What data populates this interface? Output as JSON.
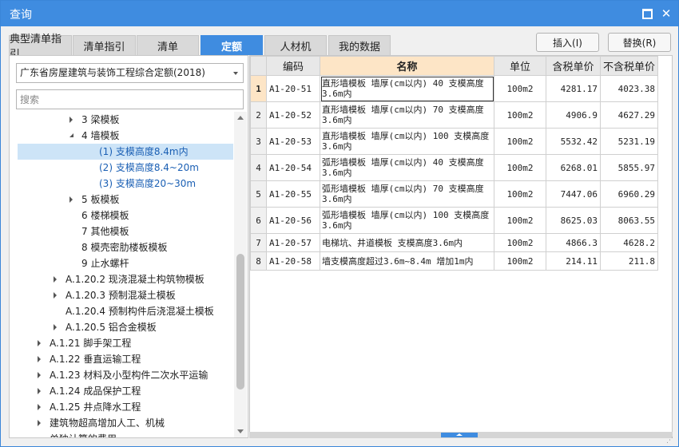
{
  "window": {
    "title": "查询"
  },
  "tabs": [
    {
      "label": "典型清单指引"
    },
    {
      "label": "清单指引"
    },
    {
      "label": "清单"
    },
    {
      "label": "定额",
      "active": true
    },
    {
      "label": "人材机"
    },
    {
      "label": "我的数据"
    }
  ],
  "actions": {
    "insert": "插入(I)",
    "replace": "替换(R)"
  },
  "left": {
    "quota_book": "广东省房屋建筑与装饰工程综合定额(2018)",
    "search_placeholder": "搜索",
    "tree": [
      {
        "label": "3 梁模板",
        "expander": "collapsed"
      },
      {
        "label": "4 墙模板",
        "expander": "expanded"
      },
      {
        "label": "(1) 支模高度8.4m内",
        "expander": "none",
        "selected": true
      },
      {
        "label": "(2) 支模高度8.4~20m",
        "expander": "none"
      },
      {
        "label": "(3) 支模高度20~30m",
        "expander": "none"
      },
      {
        "label": "5 板模板",
        "expander": "collapsed"
      },
      {
        "label": "6 楼梯模板",
        "expander": "none"
      },
      {
        "label": "7 其他模板",
        "expander": "none"
      },
      {
        "label": "8 模壳密肋楼板模板",
        "expander": "none"
      },
      {
        "label": "9 止水螺杆",
        "expander": "none"
      },
      {
        "label": "A.1.20.2 现浇混凝土构筑物模板",
        "expander": "collapsed"
      },
      {
        "label": "A.1.20.3 预制混凝土模板",
        "expander": "collapsed"
      },
      {
        "label": "A.1.20.4 预制构件后浇混凝土模板",
        "expander": "none"
      },
      {
        "label": "A.1.20.5 铝合金模板",
        "expander": "collapsed"
      },
      {
        "label": "A.1.21 脚手架工程",
        "expander": "collapsed"
      },
      {
        "label": "A.1.22 垂直运输工程",
        "expander": "collapsed"
      },
      {
        "label": "A.1.23 材料及小型构件二次水平运输",
        "expander": "collapsed"
      },
      {
        "label": "A.1.24 成品保护工程",
        "expander": "collapsed"
      },
      {
        "label": "A.1.25 井点降水工程",
        "expander": "collapsed"
      },
      {
        "label": "建筑物超高增加人工、机械",
        "expander": "collapsed"
      },
      {
        "label": "单独计算的费用",
        "expander": "none"
      }
    ]
  },
  "table": {
    "columns": [
      "",
      "编码",
      "名称",
      "单位",
      "含税单价",
      "不含税单价"
    ],
    "rows": [
      {
        "idx": "1",
        "code": "A1-20-51",
        "name": "直形墙模板 墙厚(cm以内) 40 支模高度3.6m内",
        "unit": "100m2",
        "tax_price": "4281.17",
        "notax_price": "4023.38"
      },
      {
        "idx": "2",
        "code": "A1-20-52",
        "name": "直形墙模板 墙厚(cm以内) 70 支模高度3.6m内",
        "unit": "100m2",
        "tax_price": "4906.9",
        "notax_price": "4627.29"
      },
      {
        "idx": "3",
        "code": "A1-20-53",
        "name": "直形墙模板 墙厚(cm以内) 100 支模高度3.6m内",
        "unit": "100m2",
        "tax_price": "5532.42",
        "notax_price": "5231.19"
      },
      {
        "idx": "4",
        "code": "A1-20-54",
        "name": "弧形墙模板 墙厚(cm以内) 40 支模高度3.6m内",
        "unit": "100m2",
        "tax_price": "6268.01",
        "notax_price": "5855.97"
      },
      {
        "idx": "5",
        "code": "A1-20-55",
        "name": "弧形墙模板 墙厚(cm以内) 70 支模高度3.6m内",
        "unit": "100m2",
        "tax_price": "7447.06",
        "notax_price": "6960.29"
      },
      {
        "idx": "6",
        "code": "A1-20-56",
        "name": "弧形墙模板 墙厚(cm以内) 100 支模高度3.6m内",
        "unit": "100m2",
        "tax_price": "8625.03",
        "notax_price": "8063.55"
      },
      {
        "idx": "7",
        "code": "A1-20-57",
        "name": "电梯坑、井道模板 支模高度3.6m内",
        "unit": "100m2",
        "tax_price": "4866.3",
        "notax_price": "4628.2"
      },
      {
        "idx": "8",
        "code": "A1-20-58",
        "name": "墙支模高度超过3.6m~8.4m 增加1m内",
        "unit": "100m2",
        "tax_price": "214.11",
        "notax_price": "211.8"
      }
    ]
  },
  "colors": {
    "accent": "#3f8ce0",
    "header_highlight": "#fde5c6",
    "selection": "#cde4f7"
  }
}
